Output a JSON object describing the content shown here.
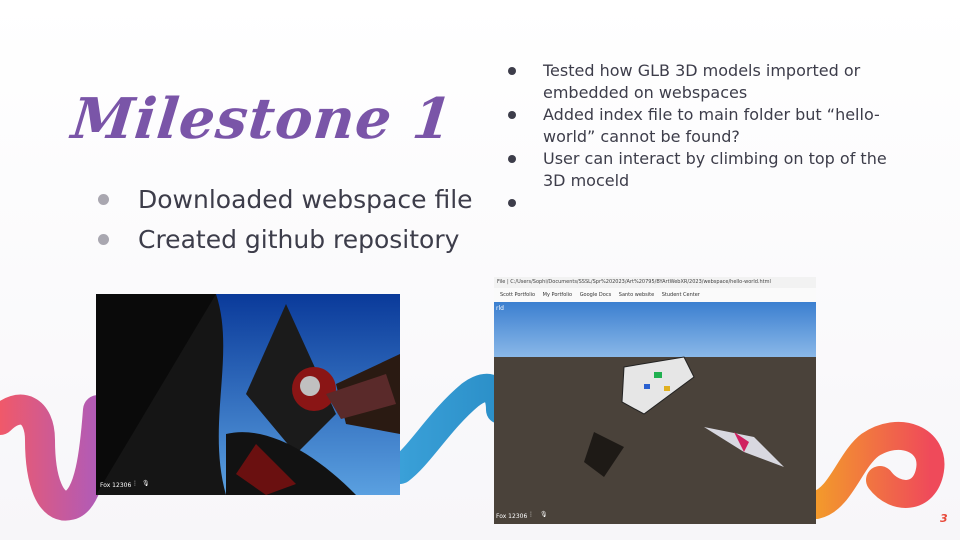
{
  "slide": {
    "title": "Milestone 1",
    "left_bullets": [
      "Downloaded webspace file",
      "Created github repository"
    ],
    "right_bullets": [
      "Tested how GLB 3D models imported or embedded on webspaces",
      "Added index file to main folder but “hello-world” cannot be found?",
      "User can interact by climbing on top of the 3D moceld",
      ""
    ],
    "page_number": "3"
  },
  "screenshot_left": {
    "overlay_text": "Fox 12306"
  },
  "screenshot_right": {
    "address": "File | C:/Users/Sophi/Documents/SSSL/Spr%202023/Art%20795/BYArtWebXR/2023/webspace/hello-world.html",
    "bookmarks": [
      "Scott Portfolio",
      "My Portfolio",
      "Google Docs",
      "Santo website",
      "Student Center"
    ],
    "corner_label": "rld",
    "overlay_text": "Fox 12306"
  },
  "colors": {
    "title": "#7a55a8",
    "text": "#3d3d4a",
    "accent_red": "#e8493a"
  }
}
